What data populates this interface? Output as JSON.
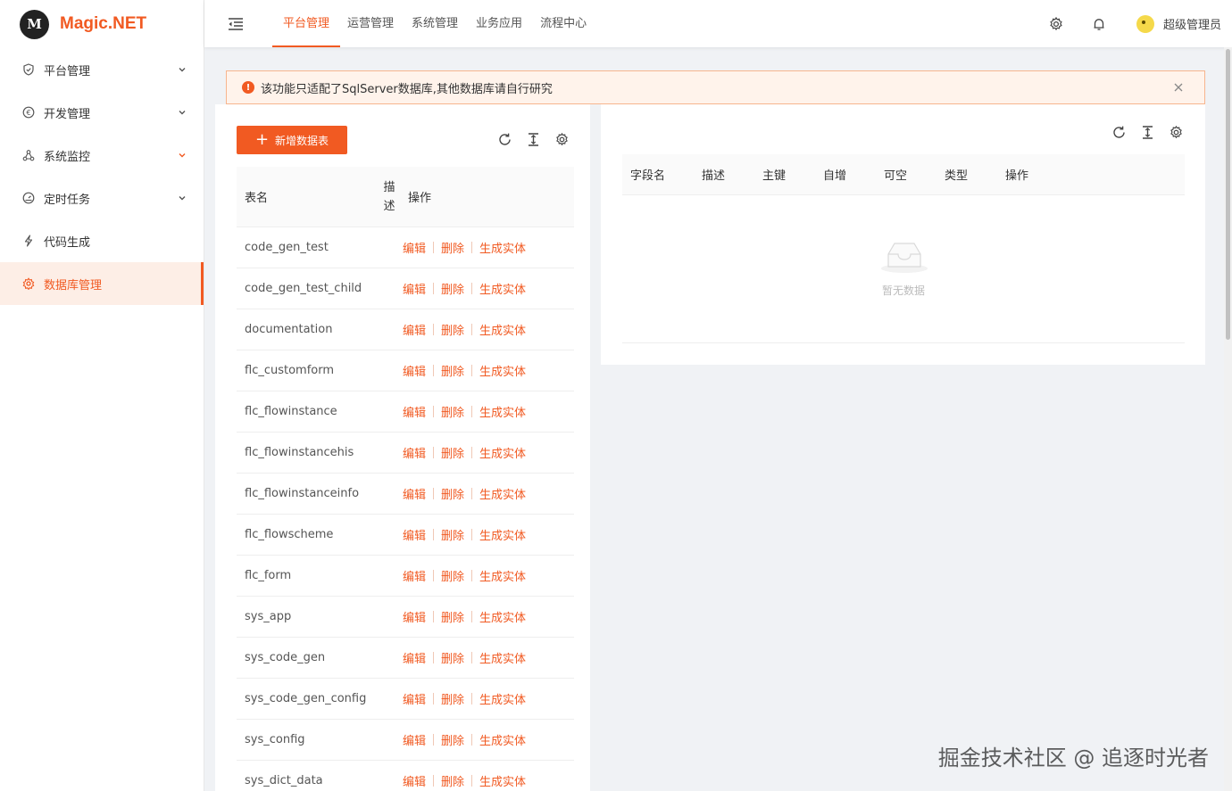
{
  "app": {
    "logo_mark": "M",
    "name": "Magic.NET"
  },
  "sidebar": {
    "items": [
      {
        "label": "平台管理",
        "icon": "shield-icon",
        "expandable": true
      },
      {
        "label": "开发管理",
        "icon": "currency-icon",
        "expandable": true
      },
      {
        "label": "系统监控",
        "icon": "cluster-icon",
        "expandable": true
      },
      {
        "label": "定时任务",
        "icon": "dashboard-icon",
        "expandable": true
      },
      {
        "label": "代码生成",
        "icon": "lightning-icon",
        "expandable": false
      },
      {
        "label": "数据库管理",
        "icon": "database-icon",
        "expandable": false,
        "active": true
      }
    ]
  },
  "header": {
    "tabs": [
      "平台管理",
      "运营管理",
      "系统管理",
      "业务应用",
      "流程中心"
    ],
    "active_tab": "平台管理",
    "username": "超级管理员"
  },
  "alert": {
    "text": "该功能只适配了SqlServer数据库,其他数据库请自行研究"
  },
  "left_table": {
    "add_button": "新增数据表",
    "columns": {
      "name": "表名",
      "desc_1": "描",
      "desc_2": "述",
      "ops": "操作"
    },
    "actions": {
      "edit": "编辑",
      "delete": "删除",
      "generate": "生成实体"
    },
    "rows": [
      "code_gen_test",
      "code_gen_test_child",
      "documentation",
      "flc_customform",
      "flc_flowinstance",
      "flc_flowinstancehis",
      "flc_flowinstanceinfo",
      "flc_flowscheme",
      "flc_form",
      "sys_app",
      "sys_code_gen",
      "sys_code_gen_config",
      "sys_config",
      "sys_dict_data"
    ]
  },
  "right_table": {
    "columns": [
      "字段名",
      "描述",
      "主键",
      "自增",
      "可空",
      "类型",
      "操作"
    ],
    "empty_text": "暂无数据"
  },
  "watermark": "掘金技术社区 @ 追逐时光者",
  "colors": {
    "accent": "#f15a22",
    "active_bg": "#fdeee6",
    "alert_bg": "#fff3eb"
  }
}
